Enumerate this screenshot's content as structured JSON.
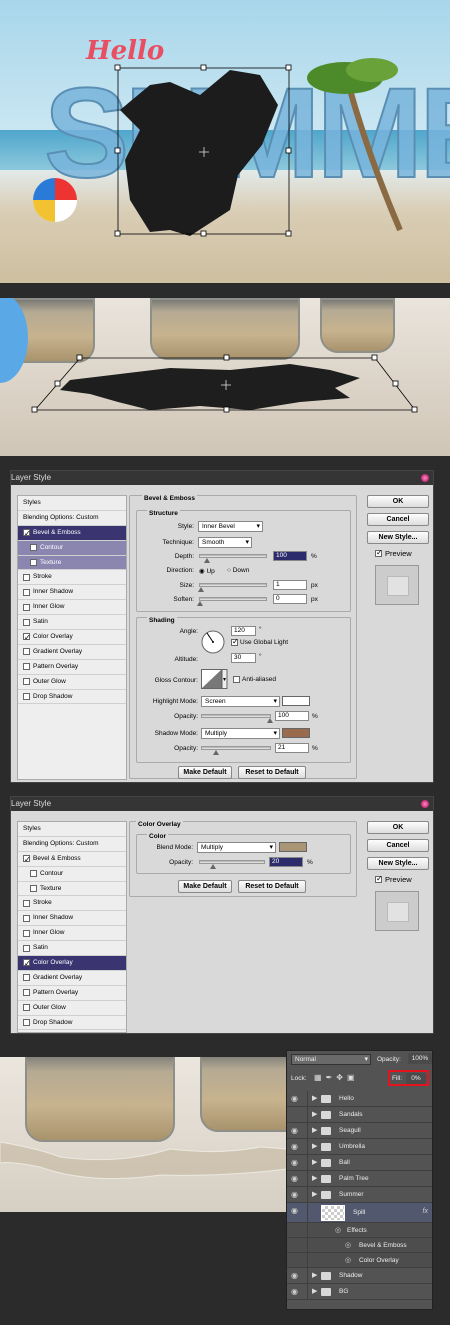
{
  "panel1": {
    "title_script": "Hello",
    "title_big": "SUMMER"
  },
  "layer_style_1": {
    "title": "Layer Style",
    "styles_header": "Styles",
    "styles": [
      {
        "label": "Blending Options: Custom",
        "checkbox": false,
        "checked": false,
        "selected": false,
        "sub": false
      },
      {
        "label": "Bevel & Emboss",
        "checkbox": true,
        "checked": true,
        "selected": true,
        "sub": false
      },
      {
        "label": "Contour",
        "checkbox": true,
        "checked": false,
        "selected": false,
        "sub": true
      },
      {
        "label": "Texture",
        "checkbox": true,
        "checked": false,
        "selected": false,
        "sub": true
      },
      {
        "label": "Stroke",
        "checkbox": true,
        "checked": false,
        "selected": false,
        "sub": false
      },
      {
        "label": "Inner Shadow",
        "checkbox": true,
        "checked": false,
        "selected": false,
        "sub": false
      },
      {
        "label": "Inner Glow",
        "checkbox": true,
        "checked": false,
        "selected": false,
        "sub": false
      },
      {
        "label": "Satin",
        "checkbox": true,
        "checked": false,
        "selected": false,
        "sub": false
      },
      {
        "label": "Color Overlay",
        "checkbox": true,
        "checked": true,
        "selected": false,
        "sub": false
      },
      {
        "label": "Gradient Overlay",
        "checkbox": true,
        "checked": false,
        "selected": false,
        "sub": false
      },
      {
        "label": "Pattern Overlay",
        "checkbox": true,
        "checked": false,
        "selected": false,
        "sub": false
      },
      {
        "label": "Outer Glow",
        "checkbox": true,
        "checked": false,
        "selected": false,
        "sub": false
      },
      {
        "label": "Drop Shadow",
        "checkbox": true,
        "checked": false,
        "selected": false,
        "sub": false
      }
    ],
    "section": "Bevel & Emboss",
    "structure": "Structure",
    "style_label": "Style:",
    "style_value": "Inner Bevel",
    "technique_label": "Technique:",
    "technique_value": "Smooth",
    "depth_label": "Depth:",
    "depth_value": "100",
    "depth_unit": "%",
    "depth_slider": 0.1,
    "direction_label": "Direction:",
    "dir_up": "Up",
    "dir_down": "Down",
    "size_label": "Size:",
    "size_value": "1",
    "size_unit": "px",
    "size_slider": 0.01,
    "soften_label": "Soften:",
    "soften_value": "0",
    "soften_unit": "px",
    "soften_slider": 0,
    "shading": "Shading",
    "angle_label": "Angle:",
    "angle_value": "120",
    "angle_unit": "°",
    "global_light": "Use Global Light",
    "altitude_label": "Altitude:",
    "altitude_value": "30",
    "altitude_unit": "°",
    "gloss_label": "Gloss Contour:",
    "anti_aliased": "Anti-aliased",
    "highlight_label": "Highlight Mode:",
    "highlight_value": "Screen",
    "highlight_color": "#ffffff",
    "hl_opacity_label": "Opacity:",
    "hl_opacity_value": "100",
    "hl_opacity_unit": "%",
    "hl_opacity_slider": 1.0,
    "shadow_label": "Shadow Mode:",
    "shadow_value": "Multiply",
    "shadow_color": "#9a6a4c",
    "sh_opacity_label": "Opacity:",
    "sh_opacity_value": "21",
    "sh_opacity_unit": "%",
    "sh_opacity_slider": 0.21,
    "make_default": "Make Default",
    "reset_default": "Reset to Default",
    "ok": "OK",
    "cancel": "Cancel",
    "new_style": "New Style...",
    "preview": "Preview"
  },
  "layer_style_2": {
    "title": "Layer Style",
    "styles_header": "Styles",
    "styles": [
      {
        "label": "Blending Options: Custom",
        "checkbox": false,
        "checked": false,
        "selected": false,
        "sub": false
      },
      {
        "label": "Bevel & Emboss",
        "checkbox": true,
        "checked": true,
        "selected": false,
        "sub": false
      },
      {
        "label": "Contour",
        "checkbox": true,
        "checked": false,
        "selected": false,
        "sub": false,
        "indent": true
      },
      {
        "label": "Texture",
        "checkbox": true,
        "checked": false,
        "selected": false,
        "sub": false,
        "indent": true
      },
      {
        "label": "Stroke",
        "checkbox": true,
        "checked": false,
        "selected": false,
        "sub": false
      },
      {
        "label": "Inner Shadow",
        "checkbox": true,
        "checked": false,
        "selected": false,
        "sub": false
      },
      {
        "label": "Inner Glow",
        "checkbox": true,
        "checked": false,
        "selected": false,
        "sub": false
      },
      {
        "label": "Satin",
        "checkbox": true,
        "checked": false,
        "selected": false,
        "sub": false
      },
      {
        "label": "Color Overlay",
        "checkbox": true,
        "checked": true,
        "selected": true,
        "sub": false
      },
      {
        "label": "Gradient Overlay",
        "checkbox": true,
        "checked": false,
        "selected": false,
        "sub": false
      },
      {
        "label": "Pattern Overlay",
        "checkbox": true,
        "checked": false,
        "selected": false,
        "sub": false
      },
      {
        "label": "Outer Glow",
        "checkbox": true,
        "checked": false,
        "selected": false,
        "sub": false
      },
      {
        "label": "Drop Shadow",
        "checkbox": true,
        "checked": false,
        "selected": false,
        "sub": false
      }
    ],
    "section": "Color Overlay",
    "color": "Color",
    "blend_label": "Blend Mode:",
    "blend_value": "Multiply",
    "overlay_color": "#a89674",
    "opacity_label": "Opacity:",
    "opacity_value": "20",
    "opacity_unit": "%",
    "opacity_slider": 0.2,
    "make_default": "Make Default",
    "reset_default": "Reset to Default",
    "ok": "OK",
    "cancel": "Cancel",
    "new_style": "New Style...",
    "preview": "Preview"
  },
  "layers": {
    "blend_mode": "Normal",
    "opacity_label": "Opacity:",
    "opacity_value": "100%",
    "lock_label": "Lock:",
    "fill_label": "Fill:",
    "fill_value": "0%",
    "rows": [
      {
        "name": "Hello",
        "kind": "folder",
        "visible": true
      },
      {
        "name": "Sandals",
        "kind": "folder",
        "visible": false
      },
      {
        "name": "Seagull",
        "kind": "folder",
        "visible": true
      },
      {
        "name": "Umbrella",
        "kind": "folder",
        "visible": true
      },
      {
        "name": "Ball",
        "kind": "folder",
        "visible": true
      },
      {
        "name": "Palm Tree",
        "kind": "folder",
        "visible": true
      },
      {
        "name": "Summer",
        "kind": "folder",
        "visible": true
      },
      {
        "name": "Spill",
        "kind": "layer",
        "visible": true,
        "selected": true,
        "fx": "fx"
      },
      {
        "name": "Effects",
        "kind": "effects",
        "visible": false
      },
      {
        "name": "Bevel & Emboss",
        "kind": "effect",
        "visible": false
      },
      {
        "name": "Color Overlay",
        "kind": "effect",
        "visible": false
      },
      {
        "name": "Shadow",
        "kind": "folder",
        "visible": true
      },
      {
        "name": "BG",
        "kind": "folder",
        "visible": true
      }
    ]
  }
}
